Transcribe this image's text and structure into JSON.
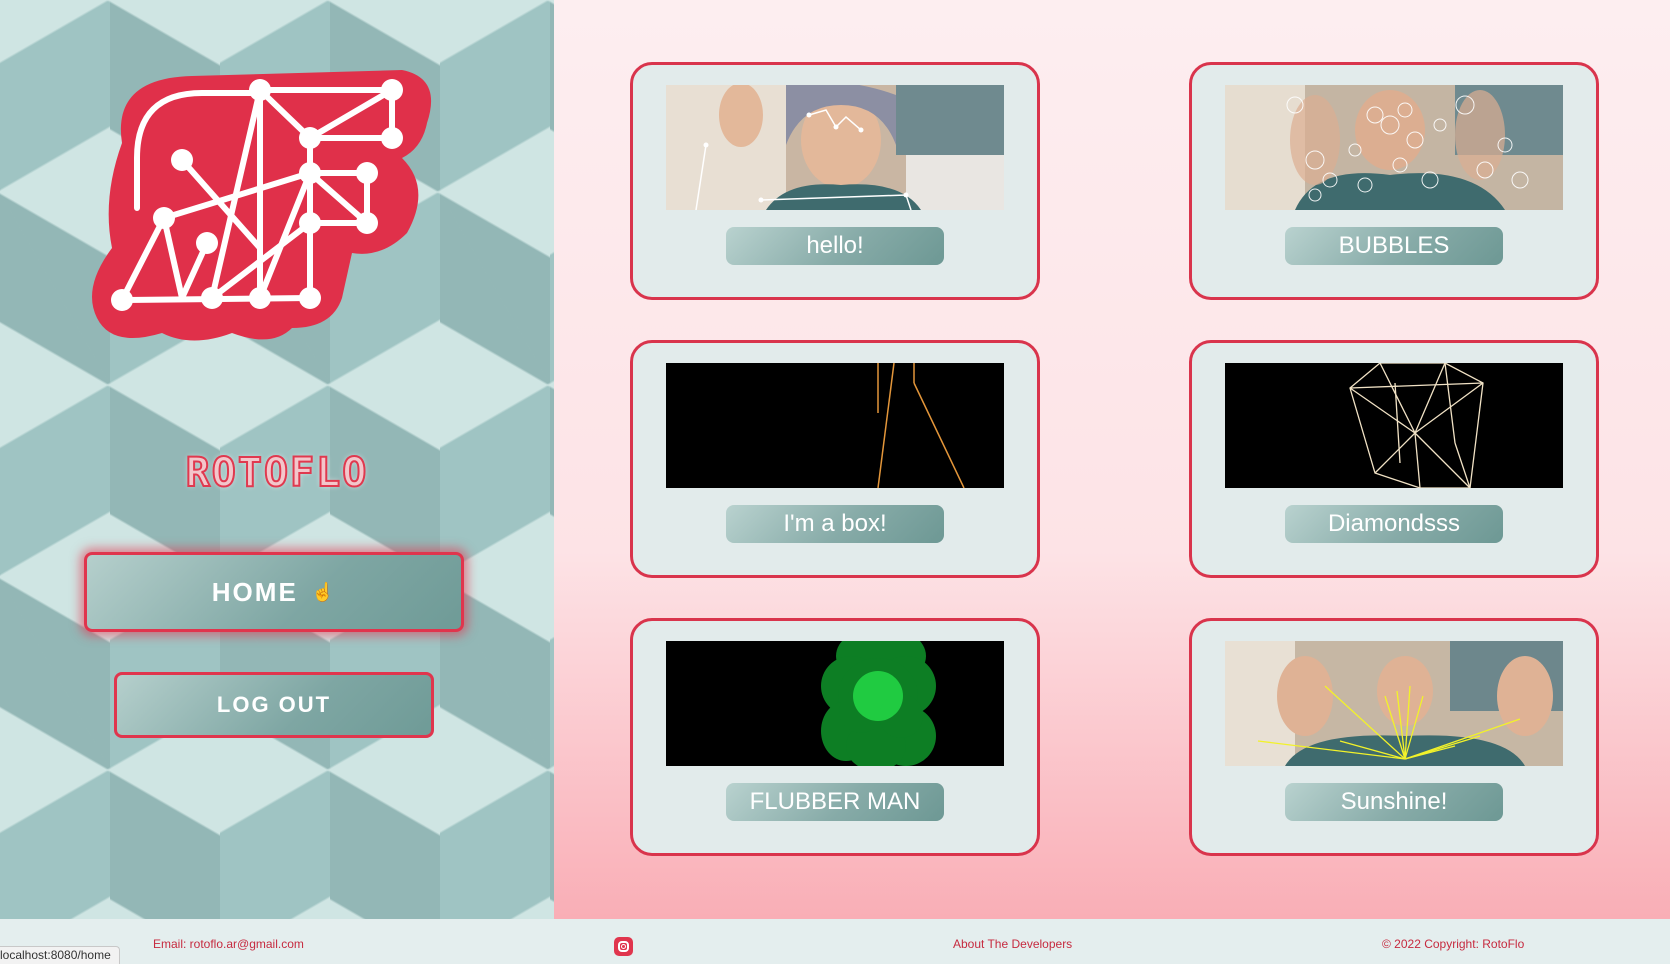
{
  "sidebar": {
    "brand": "ROTOFLO",
    "home_label": "HOME",
    "logout_label": "LOG OUT"
  },
  "cards": [
    {
      "label": "hello!",
      "thumb": "webcam-face-mesh"
    },
    {
      "label": "BUBBLES",
      "thumb": "webcam-bubbles"
    },
    {
      "label": "I'm a box!",
      "thumb": "black-orange-lines"
    },
    {
      "label": "Diamondsss",
      "thumb": "black-diamond-wireframe"
    },
    {
      "label": "FLUBBER MAN",
      "thumb": "black-green-blob"
    },
    {
      "label": "Sunshine!",
      "thumb": "webcam-sun-rays"
    }
  ],
  "footer": {
    "email": "Email: rotoflo.ar@gmail.com",
    "about": "About The Developers",
    "copyright": "© 2022 Copyright: RotoFlo",
    "social_icon": "instagram-icon"
  },
  "status_bar": {
    "url": "localhost:8080/home"
  },
  "colors": {
    "accent": "#e0354d",
    "teal": "#7ea6a3",
    "card_bg": "#e2ebeb"
  }
}
